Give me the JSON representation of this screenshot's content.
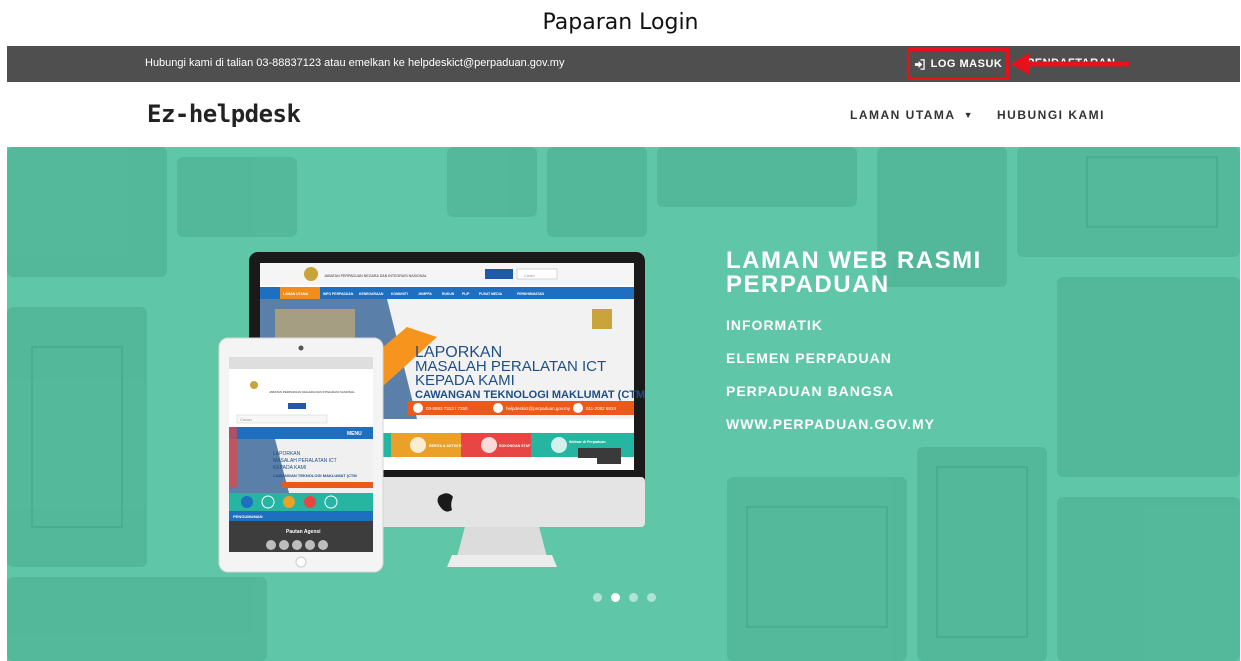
{
  "caption": "Paparan Login",
  "topbar": {
    "contact_text": "Hubungi kami di talian 03-88837123 atau emelkan ke helpdeskict@perpaduan.gov.my",
    "login_label": "LOG MASUK",
    "register_label": "PENDAFTARAN",
    "annotation_color": "#e8101a"
  },
  "navbar": {
    "brand": "Ez-helpdesk",
    "items": [
      {
        "label": "LAMAN UTAMA",
        "has_dropdown": true
      },
      {
        "label": "HUBUNGI KAMI",
        "has_dropdown": false
      }
    ]
  },
  "hero": {
    "background_color": "#5fc7a8",
    "title": "LAMAN WEB RASMI PERPADUAN",
    "lines": [
      "INFORMATIK",
      "ELEMEN PERPADUAN",
      "PERPADUAN BANGSA",
      "WWW.PERPADUAN.GOV.MY"
    ],
    "slide_count": 4,
    "active_slide": 1,
    "monitor_screen": {
      "header_title": "JABATAN PERPADUAN NEGARA DAN INTEGRASI NASIONAL",
      "search_placeholder": "Carian",
      "menu": [
        "LAMAN UTAMA",
        "INFO PERPADUAN",
        "KENEGARAAN",
        "KOMUNITI",
        "JKMPPA",
        "RUKUN",
        "PLIP",
        "PUSAT MEDIA",
        "PERKHIDMATAN"
      ],
      "banner_lines": [
        "LAPORKAN",
        "MASALAH PERALATAN ICT",
        "KEPADA KAMI",
        "CAWANGAN TEKNOLOGI MAKLUMAT (CTM"
      ],
      "contact_phone": "03-8883 7313 / 7250",
      "contact_email": "helpdeskict@perpaduan.gov.my",
      "contact_mobile": "011-2082 6824",
      "tiles": [
        "BERITA & AKTIVITI",
        "SOKONGAN STAF",
        "Ikhtisar di Perpaduan"
      ]
    },
    "tablet_screen": {
      "header_title": "JABATAN PERPADUAN NEGARA DAN INTEGRASI NASIONAL",
      "search_placeholder": "Carian",
      "menu_label": "MENU",
      "banner_lines": [
        "LAPORKAN",
        "MASALAH PERALATAN ICT",
        "KEPADA KAMI",
        "CAWANGAN TEKNOLOGI MAKLUMAT (CTM"
      ],
      "section_label": "PENGUMUMAN",
      "footer_label": "Pautan Agensi"
    }
  }
}
